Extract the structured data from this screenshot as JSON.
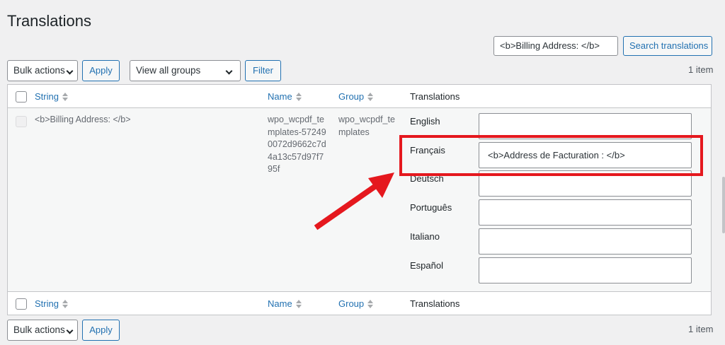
{
  "page": {
    "title": "Translations"
  },
  "search": {
    "value": "<b>Billing Address: </b>",
    "button_label": "Search translations"
  },
  "top_nav": {
    "bulk_actions": "Bulk actions",
    "apply_label": "Apply",
    "group_filter": "View all groups",
    "filter_label": "Filter",
    "items_count": "1 item"
  },
  "bottom_nav": {
    "bulk_actions": "Bulk actions",
    "apply_label": "Apply",
    "items_count": "1 item"
  },
  "table": {
    "headers": {
      "string": "String",
      "name": "Name",
      "group": "Group",
      "translations": "Translations"
    },
    "row": {
      "string": "<b>Billing Address: </b>",
      "name_lines": [
        "wpo_wcpdf_te",
        "mplates-57249",
        "0072d9662c7d",
        "4a13c57d97f7",
        "95f"
      ],
      "group_lines": [
        "wpo_wcpdf_te",
        "mplates"
      ],
      "translations": [
        {
          "language": "English",
          "value": ""
        },
        {
          "language": "Français",
          "value": "<b>Address de Facturation : </b>"
        },
        {
          "language": "Deutsch",
          "value": ""
        },
        {
          "language": "Português",
          "value": ""
        },
        {
          "language": "Italiano",
          "value": ""
        },
        {
          "language": "Español",
          "value": ""
        }
      ]
    }
  },
  "colors": {
    "accent": "#2271b1",
    "highlight": "#e5181e"
  }
}
